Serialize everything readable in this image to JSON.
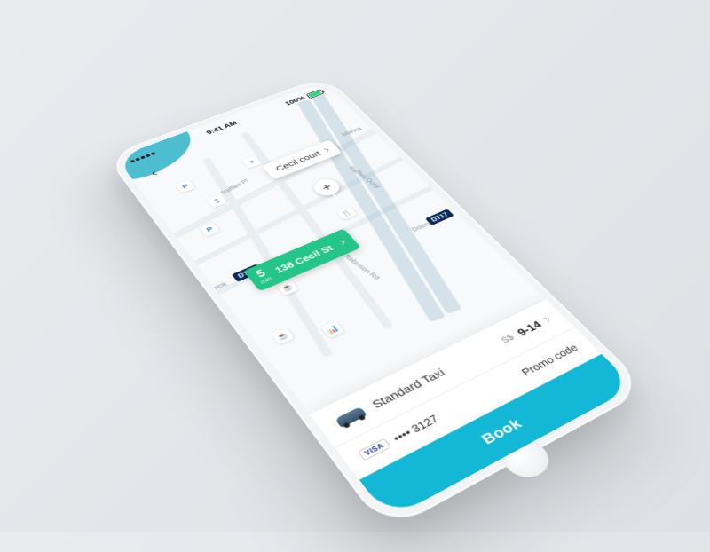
{
  "status": {
    "time": "9:41 AM",
    "battery_pct": "100%"
  },
  "map": {
    "destination_label": "Cecil court",
    "pickup_eta_value": "5",
    "pickup_eta_unit": "min",
    "pickup_address": "138 Cecil St",
    "roads": {
      "raffles_pl": "Raffles Pl",
      "raffles_quay": "Raffles Quay",
      "robinson_rd": "Robinson Rd",
      "marina": "Marina",
      "telok": "elok",
      "downtown": "Downtown"
    },
    "metro": {
      "dt17": "DT17",
      "dt18": "DT18"
    }
  },
  "panel": {
    "vehicle_name": "Standard Taxi",
    "fare_currency": "S$",
    "fare_range": "9-14",
    "card_brand": "VISA",
    "card_mask": "•••• 3127",
    "promo_label": "Promo code",
    "book_label": "Book"
  }
}
